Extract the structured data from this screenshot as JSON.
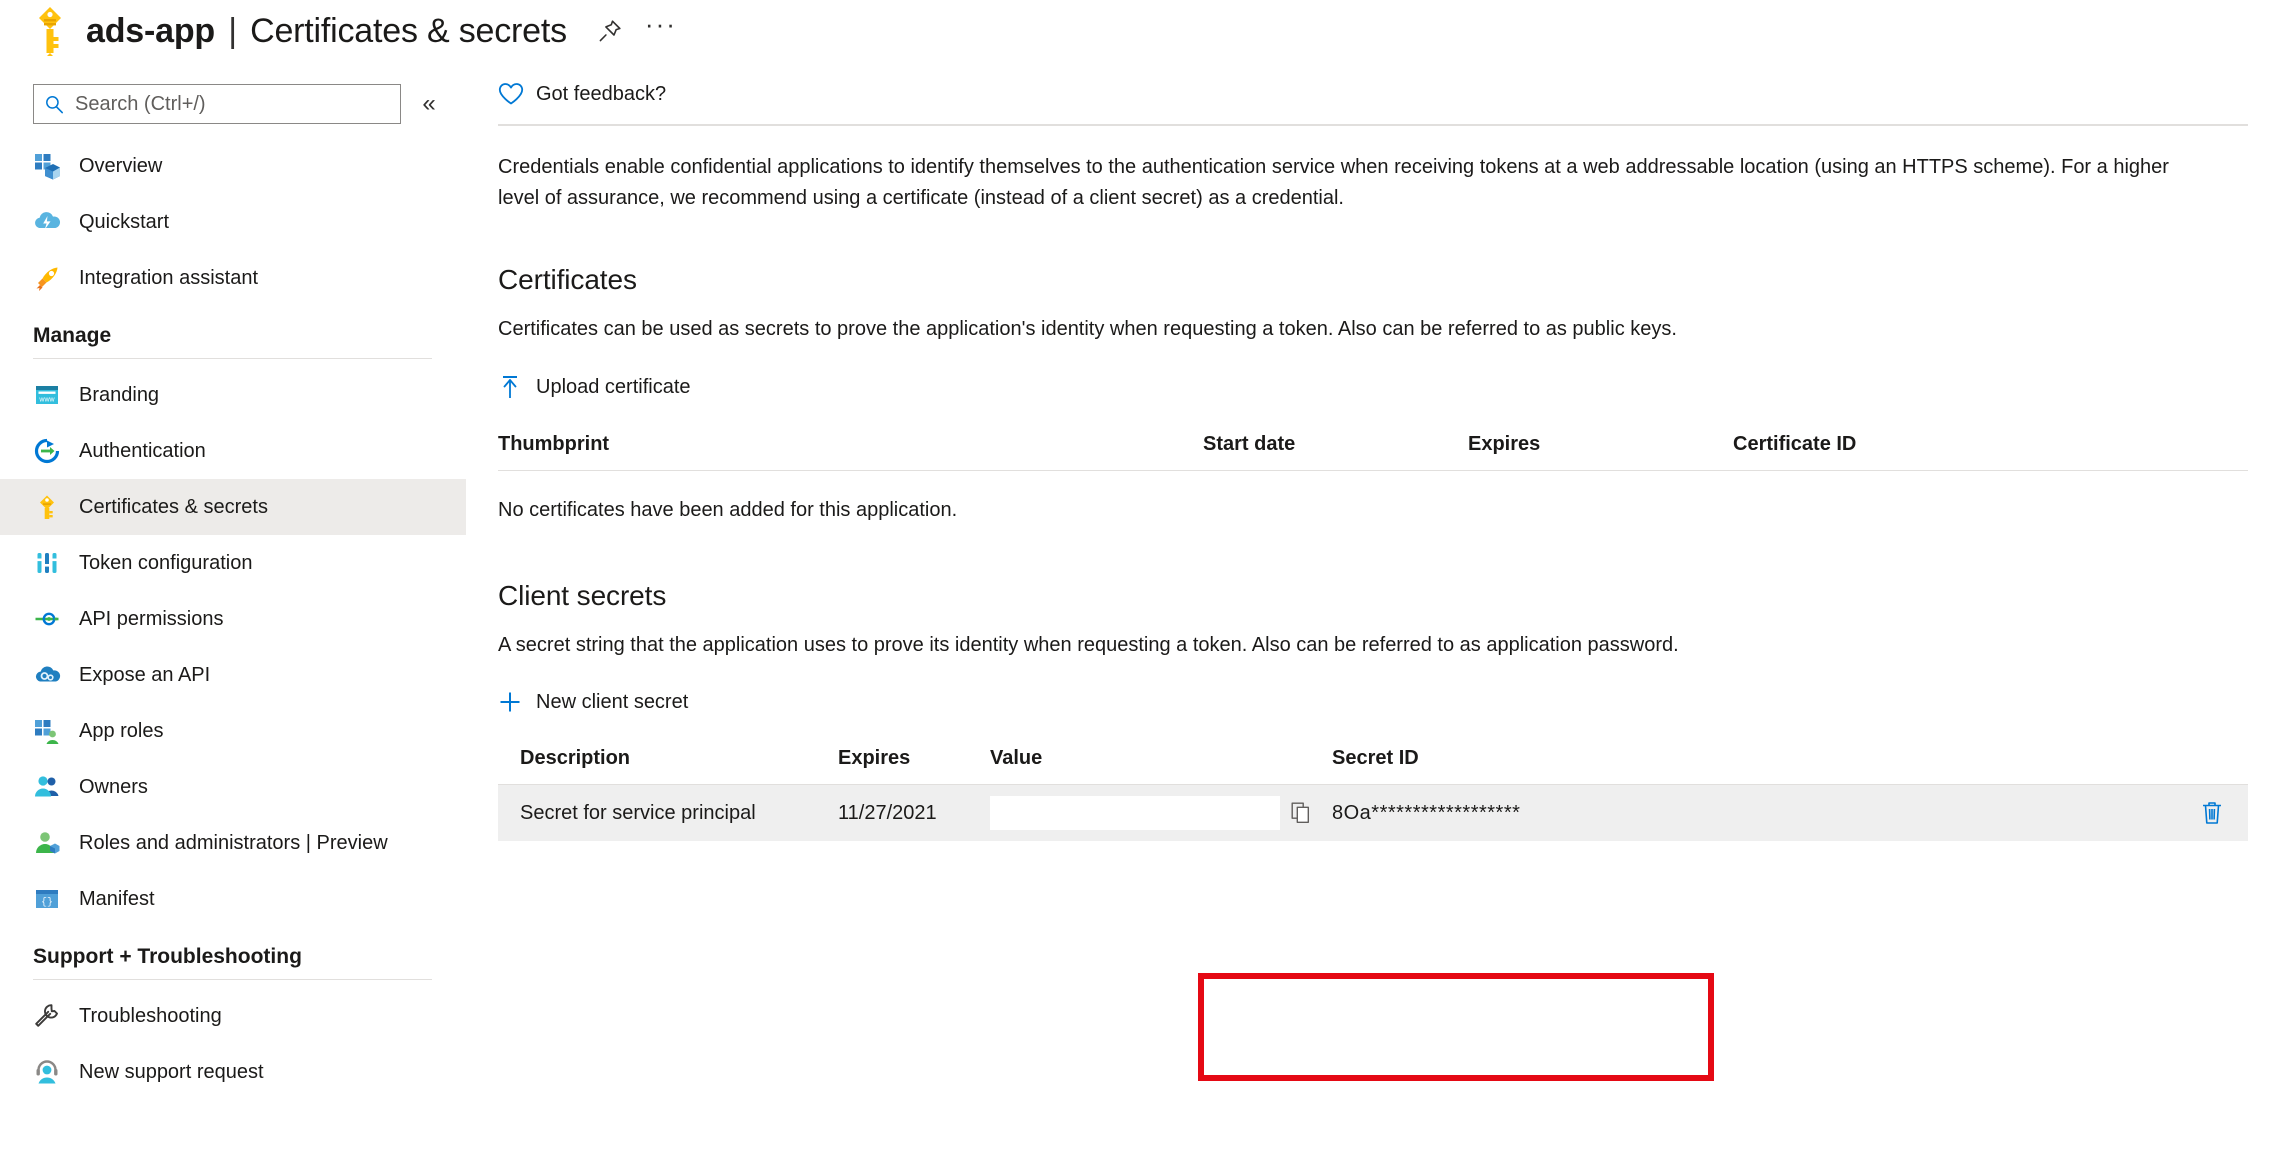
{
  "titlebar": {
    "app_name": "ads-app",
    "separator": "|",
    "page_name": "Certificates & secrets",
    "key_icon": "key-icon",
    "pin_icon": "pin-icon",
    "more_label": "···"
  },
  "sidebar": {
    "search": {
      "placeholder": "Search (Ctrl+/)",
      "value": "",
      "icon": "search-icon"
    },
    "collapse_label": "«",
    "top_items": [
      {
        "label": "Overview",
        "icon": "overview-icon"
      },
      {
        "label": "Quickstart",
        "icon": "quickstart-cloud-icon"
      },
      {
        "label": "Integration assistant",
        "icon": "rocket-icon"
      }
    ],
    "groups": [
      {
        "title": "Manage",
        "items": [
          {
            "label": "Branding",
            "icon": "branding-www-icon"
          },
          {
            "label": "Authentication",
            "icon": "authentication-arrow-icon"
          },
          {
            "label": "Certificates & secrets",
            "icon": "key-icon",
            "selected": true
          },
          {
            "label": "Token configuration",
            "icon": "token-bars-icon"
          },
          {
            "label": "API permissions",
            "icon": "api-permissions-icon"
          },
          {
            "label": "Expose an API",
            "icon": "expose-api-cloud-icon"
          },
          {
            "label": "App roles",
            "icon": "app-roles-icon"
          },
          {
            "label": "Owners",
            "icon": "owners-people-icon"
          },
          {
            "label": "Roles and administrators | Preview",
            "icon": "roles-admin-icon"
          },
          {
            "label": "Manifest",
            "icon": "manifest-braces-icon"
          }
        ]
      },
      {
        "title": "Support + Troubleshooting",
        "items": [
          {
            "label": "Troubleshooting",
            "icon": "wrench-icon"
          },
          {
            "label": "New support request",
            "icon": "support-agent-icon"
          }
        ]
      }
    ]
  },
  "command_bar": {
    "feedback_label": "Got feedback?",
    "feedback_icon": "heart-icon"
  },
  "intro": "Credentials enable confidential applications to identify themselves to the authentication service when receiving tokens at a web addressable location (using an HTTPS scheme). For a higher level of assurance, we recommend using a certificate (instead of a client secret) as a credential.",
  "certificates": {
    "title": "Certificates",
    "description": "Certificates can be used as secrets to prove the application's identity when requesting a token. Also can be referred to as public keys.",
    "upload_label": "Upload certificate",
    "upload_icon": "upload-arrow-icon",
    "columns": [
      "Thumbprint",
      "Start date",
      "Expires",
      "Certificate ID"
    ],
    "rows": [],
    "empty_message": "No certificates have been added for this application."
  },
  "client_secrets": {
    "title": "Client secrets",
    "description": "A secret string that the application uses to prove its identity when requesting a token. Also can be referred to as application password.",
    "new_label": "New client secret",
    "new_icon": "plus-icon",
    "columns": [
      "Description",
      "Expires",
      "Value",
      "Secret ID"
    ],
    "rows": [
      {
        "description": "Secret for service principal",
        "expires": "11/27/2021",
        "value": "",
        "copy_icon": "copy-icon",
        "secret_id": "8Oa******************",
        "delete_icon": "trash-icon"
      }
    ]
  },
  "annotation": {
    "color": "#e50914",
    "target": "client-secret-value-field"
  }
}
